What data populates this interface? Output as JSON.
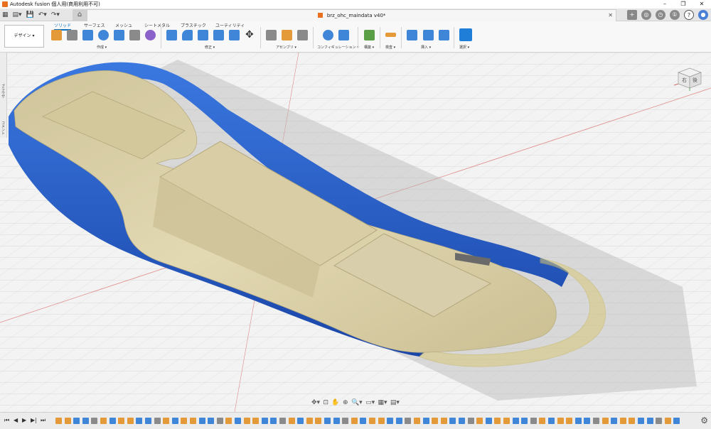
{
  "title_bar": {
    "title": "Autodesk fusion 個人用(商用利用不可)"
  },
  "document": {
    "name": "brz_ohc_maindata v40*"
  },
  "toolbar": {
    "workspace": "デザイン ▾",
    "tabs": [
      "ソリッド",
      "サーフェス",
      "メッシュ",
      "シートメタル",
      "プラスチック",
      "ユーティリティ"
    ],
    "active_tab": "ソリッド",
    "groups": [
      "作成 ▾",
      "修正 ▾",
      "アセンブリ ▾",
      "コンフィギュレーション ▾",
      "構築 ▾",
      "検査 ▾",
      "挿入 ▾",
      "選択 ▾"
    ]
  },
  "left_panel": {
    "labels": [
      "ブラウザ",
      "コメント"
    ]
  },
  "viewcube": {
    "faces": [
      "右",
      "後"
    ]
  },
  "colors": {
    "grid": "#c8c8c8",
    "mesh": "#ddd2a8",
    "frame": "#2459c9",
    "accent": "#0b6fc0"
  },
  "icons": [
    "home-icon",
    "undo-icon",
    "redo-icon",
    "save-icon",
    "grid-icon",
    "plus-icon",
    "orbit-icon",
    "pan-icon",
    "zoom-icon",
    "display-icon",
    "settings-icon"
  ]
}
